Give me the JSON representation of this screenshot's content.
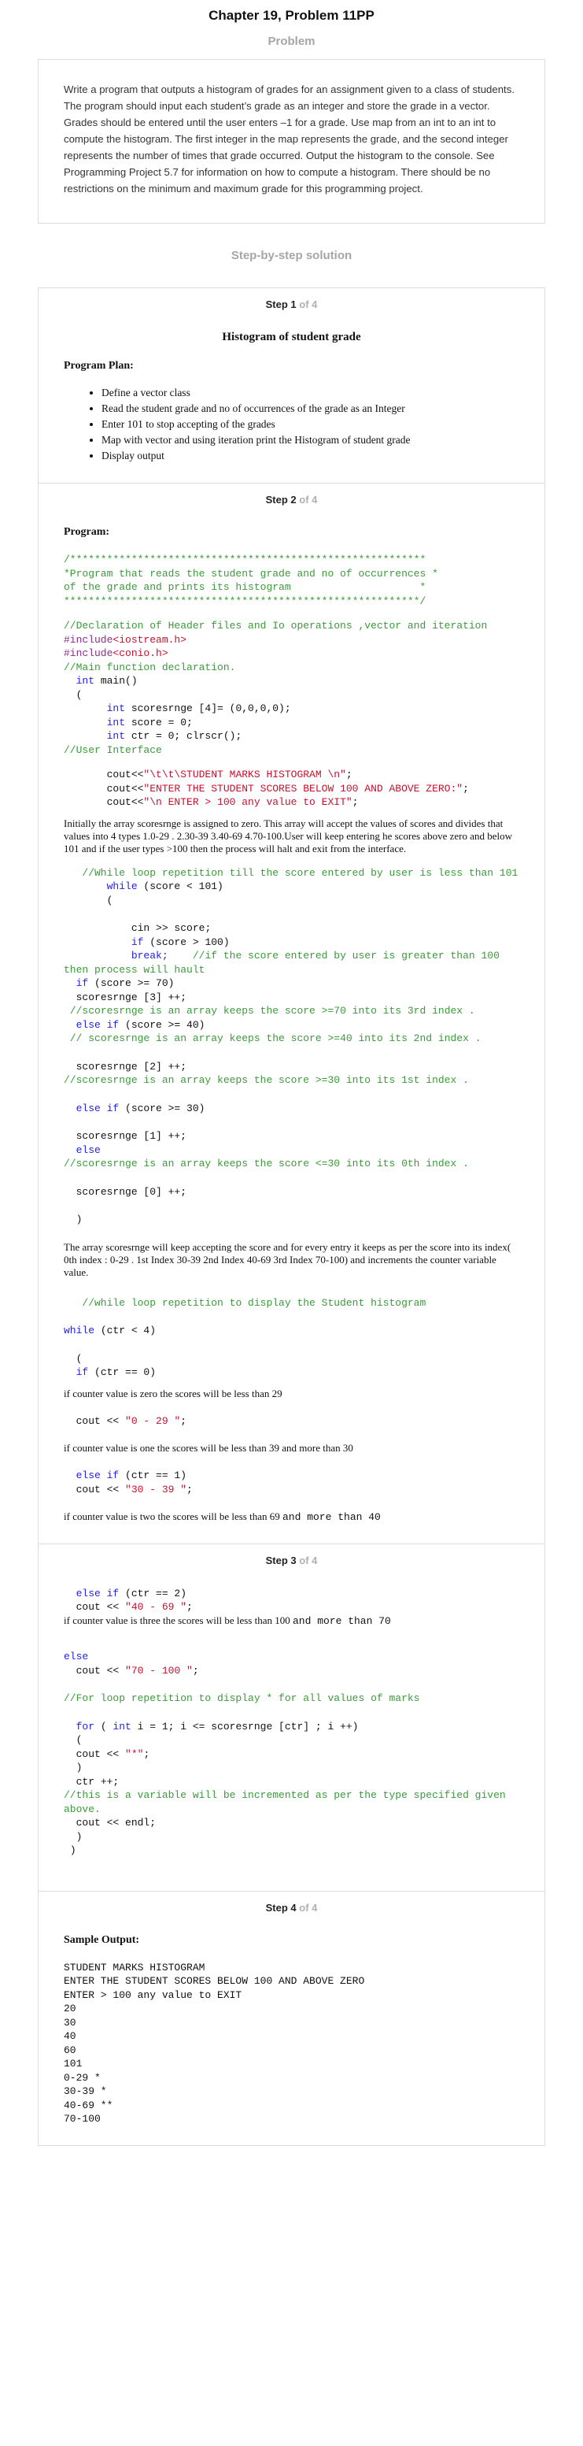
{
  "header": {
    "title": "Chapter 19, Problem 11PP"
  },
  "problem": {
    "heading": "Problem",
    "text": "Write a program that outputs a histogram of grades for an assignment given to a class of students. The program should input each student’s grade as an integer and store the grade in a vector. Grades should be entered until the user enters –1 for a grade. Use map from an int to an int to compute the histogram. The first integer in the map represents the grade, and the second integer represents the number of times that grade occurred. Output the histogram to the console. See Programming Project 5.7 for information on how to compute a histogram. There should be no restrictions on the minimum and maximum grade for this programming project."
  },
  "solution": {
    "heading": "Step-by-step solution",
    "step_word": "Step",
    "of_total": "of 4",
    "step1": {
      "num": "1",
      "title": "Histogram of student grade",
      "plan_heading": "Program Plan:",
      "plan_items": [
        "Define a vector class",
        "Read the student grade and no of occurrences  of the grade as an Integer",
        "Enter 101 to stop accepting of the grades",
        "Map with vector  and using iteration  print the Histogram of student grade",
        "Display output"
      ]
    },
    "step2": {
      "num": "2",
      "program_heading": "Program:",
      "banner": "/**********************************************************\n*Program that reads the student grade and no of occurrences *\nof the grade and prints its histogram                     *\n**********************************************************/",
      "decl_comment": "//Declaration of Header files and Io operations ,vector and iteration",
      "include1_kw": "#include",
      "include1_file": "<iostream.h>",
      "include2_kw": "#include",
      "include2_file": "<conio.h>",
      "main_comment": "//Main function declaration.",
      "int_kw": "int",
      "main_sig": " main()",
      "open_brace": "(",
      "decl1_rest": " scoresrnge [4]= (0,0,0,0);",
      "decl2_rest": " score = 0;",
      "decl3_rest": " ctr = 0; clrscr();",
      "ui_comment": "//User Interface",
      "cout1_a": "cout<<",
      "cout1_b": "\"\\t\\t\\STUDENT MARKS HISTOGRAM \\n\"",
      "cout1_c": ";",
      "cout2_a": "cout<<",
      "cout2_b": "\"ENTER THE STUDENT SCORES BELOW 100 AND ABOVE ZERO:\"",
      "cout2_c": ";",
      "cout3_a": "cout<<",
      "cout3_b": "\"\\n ENTER > 100 any value to EXIT\"",
      "cout3_c": ";",
      "para1": "Initially the array scoresrnge is assigned to zero. This array will accept the values of scores and divides that values into 4 types 1.0-29 . 2.30-39  3.40-69  4.70-100.User will keep entering he scores above zero and below 101 and if the user types >100  then the process will halt and exit from the interface.",
      "while_comment": "//While loop repetition till the score entered by user is less than 101",
      "while_kw": "while",
      "while_rest": " (score < 101)",
      "while_brace": "(",
      "cin_line": "cin >> score;",
      "if_kw": "if",
      "if_rest": " (score > 100)",
      "break_kw": "break;",
      "break_comment": "    //if the score entered by user is greater than 100 then process will hault",
      "if70_kw": "if",
      "if70_rest": " (score >= 70)",
      "inc3": "scoresrnge [3] ++;",
      "comment3": " //scoresrnge is an array keeps the score >=70 into its 3rd index .",
      "elseif40_kw": "else if",
      "elseif40_rest": " (score >= 40)",
      "comment2a": " // scoresrnge is an array keeps the score >=40 into its 2nd index .",
      "inc2": "scoresrnge [2] ++;",
      "comment2b": "//scoresrnge is an array keeps the score >=30 into its 1st index .",
      "elseif30_kw": "else if",
      "elseif30_rest": " (score >= 30)",
      "inc1": "scoresrnge [1] ++;",
      "else_kw": "else",
      "comment0": "//scoresrnge is an array keeps the score <=30 into its 0th index .",
      "inc0": "scoresrnge [0] ++;",
      "close_paren": ")",
      "para2": "The array scoresrnge will keep accepting the score and for every entry it keeps as per the score into its index( 0th index : 0-29 . 1st Index 30-39   2nd Index 40-69  3rd Index  70-100) and increments the counter variable value.",
      "while2_comment": "//while loop repetition to display the Student histogram",
      "while2_kw": "while",
      "while2_rest": " (ctr < 4)",
      "while2_brace": "(",
      "if0_kw": "if",
      "if0_rest": " (ctr == 0)",
      "para3": "if counter value is zero  the scores will be less than 29",
      "cout029_a": "cout << ",
      "cout029_b": "\"0 - 29 \"",
      "cout029_c": ";",
      "para4": "if counter value is one  the scores will be less than 39 and more than 30",
      "elseif1_kw": "else if",
      "elseif1_rest": " (ctr == 1)",
      "cout3039_a": "cout << ",
      "cout3039_b": "\"30 - 39 \"",
      "cout3039_c": ";",
      "para5_serif": "if counter value is two  the scores will be less than 69 ",
      "para5_mono": "and more than 40"
    },
    "step3": {
      "num": "3",
      "elseif2_kw": "else if",
      "elseif2_rest": " (ctr == 2)",
      "cout4069_a": "cout << ",
      "cout4069_b": "\"40 - 69 \"",
      "cout4069_c": ";",
      "para6_serif": "if counter value is three  the scores will be less than 100 ",
      "para6_mono": "and more than 70",
      "else_kw": "else",
      "cout70100_a": "cout << ",
      "cout70100_b": "\"70 - 100 \"",
      "cout70100_c": ";",
      "for_comment": "//For loop repetition to display * for all values of marks",
      "for_kw": "for",
      "for_a": " ( ",
      "for_int": "int",
      "for_b": " i = 1; i <= scoresrnge [ctr] ; i ++)",
      "for_brace": "(",
      "coutstar_a": "cout << ",
      "coutstar_b": "\"*\"",
      "coutstar_c": ";",
      "close1": ")",
      "ctr_inc": "ctr ++;",
      "ctr_comment": "//this is a variable will be incremented as per the type specified given above.",
      "endl": "cout << endl;",
      "close2": ")",
      "close3": ")"
    },
    "step4": {
      "num": "4",
      "heading": "Sample Output:",
      "output": "STUDENT MARKS HISTOGRAM\nENTER THE STUDENT SCORES BELOW 100 AND ABOVE ZERO\nENTER > 100 any value to EXIT\n20\n30\n40\n60\n101\n0-29 *\n30-39 *\n40-69 **\n70-100"
    }
  }
}
